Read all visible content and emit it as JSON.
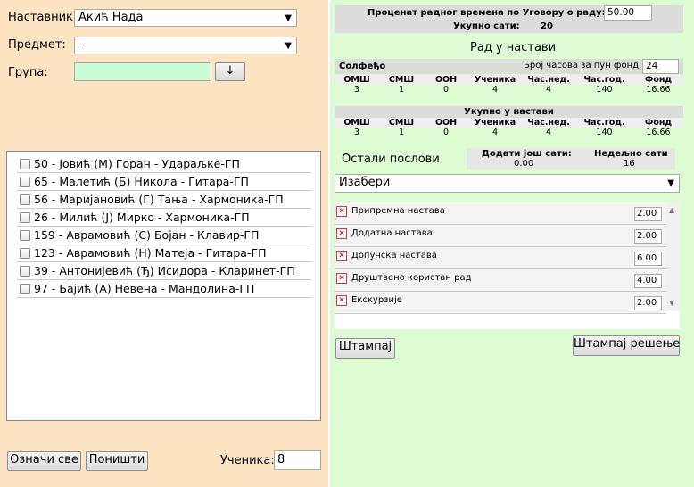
{
  "filters": {
    "teacher_label": "Наставник:",
    "teacher_value": "Акић Нада",
    "subject_label": "Предмет:",
    "subject_value": "-",
    "group_label": "Група:",
    "group_value": "",
    "group_button": "↓"
  },
  "students": [
    "50 - Јовић (М) Горан - Удараљке-ГП",
    "65 - Малетић (Б) Никола - Гитара-ГП",
    "56 - Маријановић (Г) Тања - Хармоника-ГП",
    "26 - Милић (Ј) Мирко - Хармоника-ГП",
    "159 - Аврамовић (С) Бојан - Клавир-ГП",
    "123 - Аврамовић (Н) Матеја - Гитара-ГП",
    "39 - Антонијевић (Ђ) Исидора - Кларинет-ГП",
    "97 - Бајић (А) Невена - Мандолина-ГП"
  ],
  "bottom": {
    "select_all": "Означи све",
    "clear": "Поништи",
    "students_label": "Ученика:",
    "students_value": "8"
  },
  "summary": {
    "contract_label": "Проценат радног времена по Уговору о раду:",
    "contract_value": "50.00",
    "total_label": "Укупно сати:",
    "total_value": "20"
  },
  "teaching": {
    "title": "Рад у настави",
    "subject_name": "Солфеђо",
    "full_fund_label": "Број часова за пун фонд:",
    "full_fund_value": "24",
    "headers": [
      "ОМШ",
      "СМШ",
      "ООН",
      "Ученика",
      "Час.нед.",
      "Час.год.",
      "Фонд"
    ],
    "row": [
      "3",
      "1",
      "0",
      "4",
      "4",
      "140",
      "16.66"
    ],
    "total_title": "Укупно у настави",
    "total_headers": [
      "ОМШ",
      "СМШ",
      "ООН",
      "Ученика",
      "Час.нед.",
      "Час.год.",
      "Фонд"
    ],
    "total_row": [
      "3",
      "1",
      "0",
      "4",
      "4",
      "140",
      "16.66"
    ]
  },
  "other": {
    "title": "Остали послови",
    "add_hours_label": "Додати још сати:",
    "add_hours_value": "0.00",
    "weekly_label": "Недељно сати",
    "weekly_value": "16",
    "choose_value": "Изабери",
    "tasks": [
      {
        "name": "Припремна настава",
        "value": "2.00"
      },
      {
        "name": "Додатна настава",
        "value": "2.00"
      },
      {
        "name": "Допунска настава",
        "value": "6.00"
      },
      {
        "name": "Друштвено користан рад",
        "value": "4.00"
      },
      {
        "name": "Екскурзије",
        "value": "2.00"
      }
    ]
  },
  "actions": {
    "print": "Штампај",
    "print_decision": "Штампај решење"
  }
}
